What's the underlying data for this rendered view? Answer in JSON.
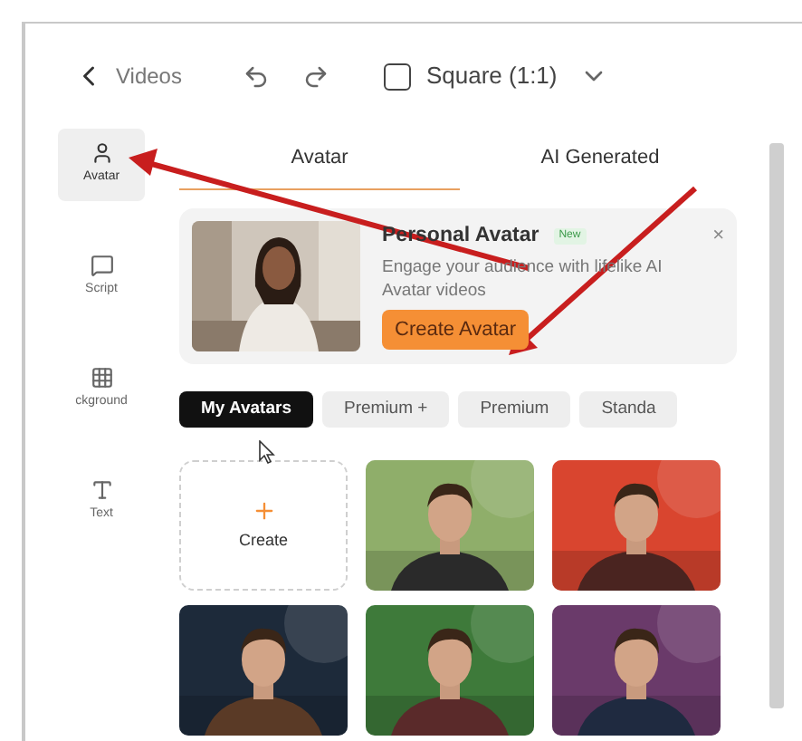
{
  "header": {
    "back_label": "Videos",
    "aspect": {
      "label": "Square (1:1)",
      "checked": false
    }
  },
  "sidebar": {
    "items": [
      {
        "label": "Avatar",
        "selected": true
      },
      {
        "label": "Script",
        "selected": false
      },
      {
        "label": "ckground",
        "selected": false
      },
      {
        "label": "Text",
        "selected": false
      }
    ]
  },
  "tabs": [
    {
      "label": "Avatar",
      "selected": true
    },
    {
      "label": "AI Generated",
      "selected": false
    }
  ],
  "promo": {
    "title": "Personal Avatar",
    "badge": "New",
    "close": "×",
    "description": "Engage your audience with lifelike AI Avatar videos",
    "button": "Create Avatar"
  },
  "filters": [
    {
      "label": "My Avatars",
      "selected": true
    },
    {
      "label": "Premium +",
      "selected": false
    },
    {
      "label": "Premium",
      "selected": false
    },
    {
      "label": "Standa",
      "selected": false
    }
  ],
  "avatars": [
    {
      "kind": "create",
      "label": "Create"
    },
    {
      "kind": "picture"
    },
    {
      "kind": "picture"
    },
    {
      "kind": "picture"
    },
    {
      "kind": "picture"
    },
    {
      "kind": "picture"
    }
  ]
}
